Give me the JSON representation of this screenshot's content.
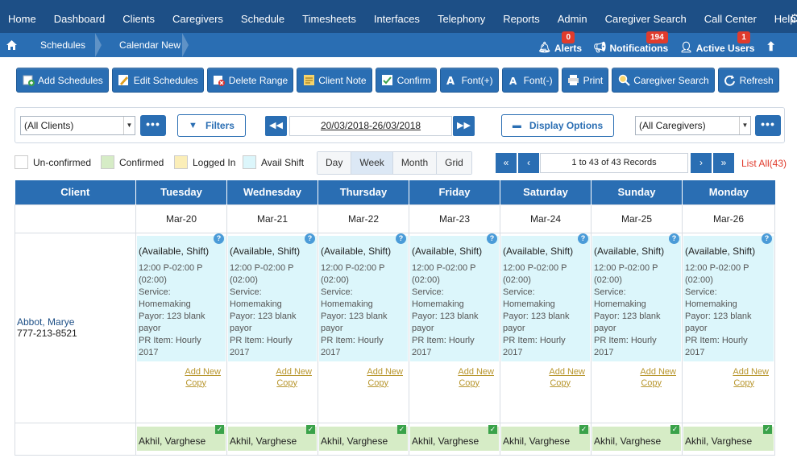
{
  "nav": {
    "items": [
      "Home",
      "Dashboard",
      "Clients",
      "Caregivers",
      "Schedule",
      "Timesheets",
      "Interfaces",
      "Telephony",
      "Reports",
      "Admin",
      "Caregiver Search",
      "Call Center",
      "Help"
    ]
  },
  "breadcrumb": {
    "items": [
      "Schedules",
      "Calendar New"
    ]
  },
  "header_right": {
    "alerts_label": "Alerts",
    "alerts_count": "0",
    "notifications_label": "Notifications",
    "notifications_count": "194",
    "active_users_label": "Active Users",
    "active_users_count": "1"
  },
  "toolbar": {
    "buttons": [
      {
        "label": "Add Schedules",
        "icon": "add-schedule-icon"
      },
      {
        "label": "Edit Schedules",
        "icon": "edit-icon"
      },
      {
        "label": "Delete Range",
        "icon": "delete-icon"
      },
      {
        "label": "Client Note",
        "icon": "note-icon"
      },
      {
        "label": "Confirm",
        "icon": "confirm-icon"
      },
      {
        "label": "Font(+)",
        "icon": "font-increase-icon"
      },
      {
        "label": "Font(-)",
        "icon": "font-decrease-icon"
      },
      {
        "label": "Print",
        "icon": "printer-icon"
      },
      {
        "label": "Caregiver Search",
        "icon": "search-icon"
      },
      {
        "label": "Refresh",
        "icon": "refresh-icon"
      }
    ]
  },
  "filters": {
    "client_select": "(All Clients)",
    "filters_label": "Filters",
    "date_range": "20/03/2018-26/03/2018",
    "display_options_label": "Display Options",
    "caregiver_select": "(All Caregivers)",
    "dots": "•••"
  },
  "legend": {
    "unconfirmed": "Un-confirmed",
    "confirmed": "Confirmed",
    "logged_in": "Logged In",
    "avail_shift": "Avail Shift",
    "colors": {
      "unconfirmed": "#ffffff",
      "confirmed": "#d6ecc6",
      "logged_in": "#fbeeb8",
      "avail_shift": "#dcf6fb"
    }
  },
  "views": [
    "Day",
    "Week",
    "Month",
    "Grid"
  ],
  "active_view": "Week",
  "pager": {
    "info": "1 to 43 of 43 Records",
    "list_all": "List All(43)"
  },
  "calendar": {
    "client_header": "Client",
    "days": [
      {
        "name": "Tuesday",
        "date": "Mar-20"
      },
      {
        "name": "Wednesday",
        "date": "Mar-21"
      },
      {
        "name": "Thursday",
        "date": "Mar-22"
      },
      {
        "name": "Friday",
        "date": "Mar-23"
      },
      {
        "name": "Saturday",
        "date": "Mar-24"
      },
      {
        "name": "Sunday",
        "date": "Mar-25"
      },
      {
        "name": "Monday",
        "date": "Mar-26"
      }
    ],
    "rows": [
      {
        "client_name": "Abbot, Marye",
        "client_phone": "777-213-8521",
        "shift": {
          "title": "(Available, Shift)",
          "details": [
            "12:00 P-02:00 P",
            "(02:00)",
            "Service:",
            "Homemaking",
            "Payor: 123 blank",
            "payor",
            "PR Item: Hourly",
            "2017"
          ],
          "add_new": "Add New",
          "copy": "Copy"
        }
      },
      {
        "client_name": "",
        "client_phone": "",
        "shift": {
          "title": "Akhil, Varghese"
        }
      }
    ]
  },
  "accent_color": "#2a6eb3",
  "nav_color": "#1d4f86"
}
